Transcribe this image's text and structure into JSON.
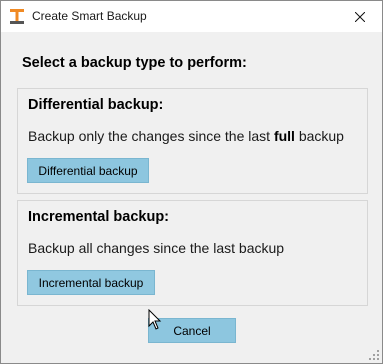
{
  "window": {
    "title": "Create Smart Backup",
    "icon": "app-logo-icon",
    "close_icon": "close-icon"
  },
  "dialog": {
    "heading": "Select a backup type to perform:",
    "differential": {
      "title": "Differential backup:",
      "description_prefix": "Backup only the changes since the last ",
      "description_bold": "full",
      "description_suffix": " backup",
      "button_label": "Differential backup"
    },
    "incremental": {
      "title": "Incremental backup:",
      "description": "Backup all changes since the last backup",
      "button_label": "Incremental backup"
    },
    "cancel_label": "Cancel"
  },
  "colors": {
    "accent_button": "#8dc6df",
    "icon_orange": "#f08a24"
  }
}
